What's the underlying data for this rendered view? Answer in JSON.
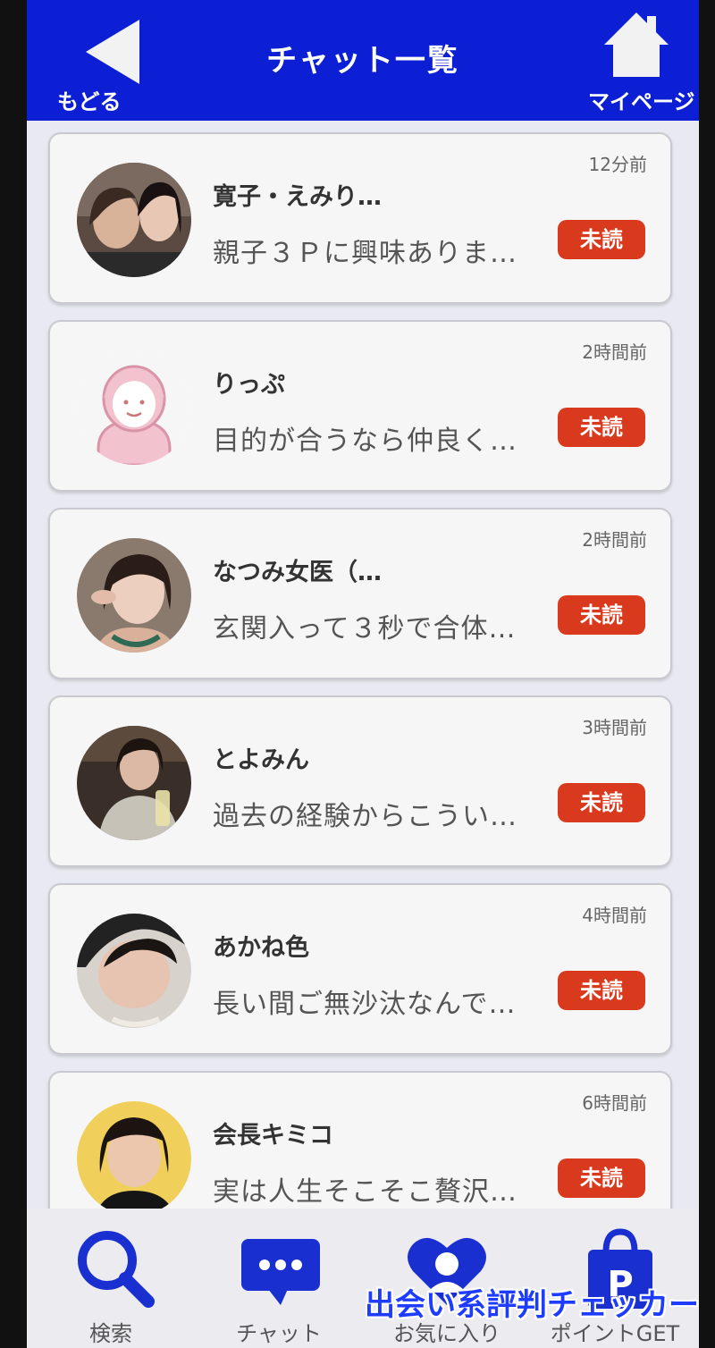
{
  "header": {
    "title": "チャット一覧",
    "back_label": "もどる",
    "mypage_label": "マイページ",
    "color": "#0c1fd4"
  },
  "chats": [
    {
      "name": "寛子・えみり…",
      "preview": "親子３Ｐに興味ありま…",
      "time": "12分前",
      "badge": "未読",
      "avatar": "photo-two-women"
    },
    {
      "name": "りっぷ",
      "preview": "目的が合うなら仲良く…",
      "time": "2時間前",
      "badge": "未読",
      "avatar": "default-female-illustration"
    },
    {
      "name": "なつみ女医（…",
      "preview": "玄関入って３秒で合体…",
      "time": "2時間前",
      "badge": "未読",
      "avatar": "photo-woman"
    },
    {
      "name": "とよみん",
      "preview": "過去の経験からこうい…",
      "time": "3時間前",
      "badge": "未読",
      "avatar": "photo-woman-with-glass"
    },
    {
      "name": "あかね色",
      "preview": "長い間ご無沙汰なんで…",
      "time": "4時間前",
      "badge": "未読",
      "avatar": "photo-woman-closeup"
    },
    {
      "name": "会長キミコ",
      "preview": "実は人生そこそこ贅沢…",
      "time": "6時間前",
      "badge": "未読",
      "avatar": "photo-woman-yellow-bg"
    }
  ],
  "bottom_nav": [
    {
      "label": "検索",
      "icon": "search-icon"
    },
    {
      "label": "チャット",
      "icon": "chat-bubble-icon"
    },
    {
      "label": "お気に入り",
      "icon": "heart-person-icon"
    },
    {
      "label": "ポイントGET",
      "icon": "shopping-bag-p-icon"
    }
  ],
  "watermark": "出会い系評判チェッカー",
  "colors": {
    "accent": "#0c1fd4",
    "unread_badge": "#d9391c",
    "icon_blue": "#1a2fd0"
  }
}
